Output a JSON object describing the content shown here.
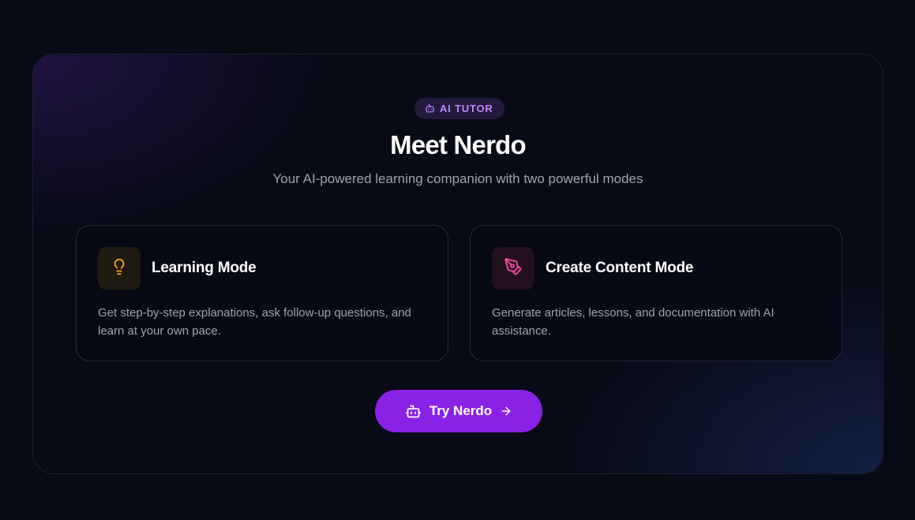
{
  "badge": {
    "label": "AI TUTOR",
    "icon": "robot-icon"
  },
  "hero": {
    "title": "Meet Nerdo",
    "subtitle": "Your AI-powered learning companion with two powerful modes"
  },
  "modes": [
    {
      "title": "Learning Mode",
      "description": "Get step-by-step explanations, ask follow-up questions, and learn at your own pace.",
      "icon": "lightbulb-icon",
      "accent": "#f59e0b"
    },
    {
      "title": "Create Content Mode",
      "description": "Generate articles, lessons, and documentation with AI assistance.",
      "icon": "pen-tool-icon",
      "accent": "#ec4899"
    }
  ],
  "cta": {
    "label": "Try Nerdo",
    "icon": "robot-icon",
    "trailing_icon": "arrow-right-icon"
  },
  "colors": {
    "brand": "#8a22e6",
    "badge_text": "#c084fc",
    "background": "#070b14"
  }
}
